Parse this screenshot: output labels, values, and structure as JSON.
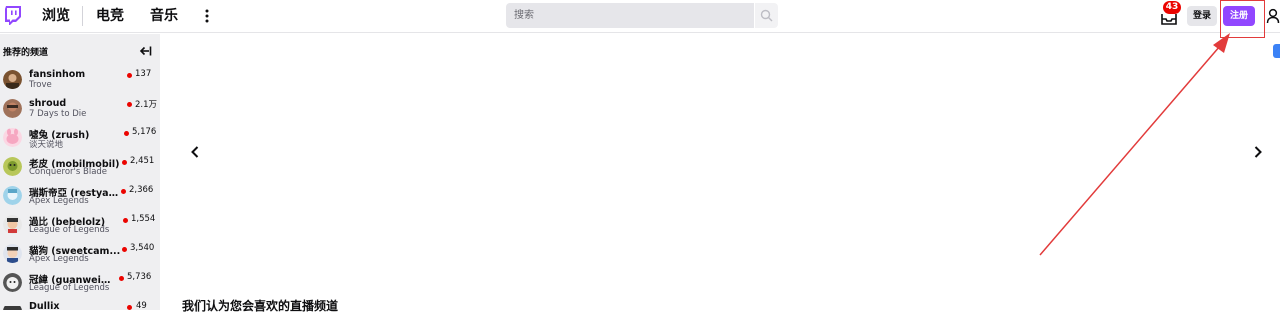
{
  "nav": {
    "links": [
      "浏览",
      "电竞",
      "音乐"
    ],
    "search_placeholder": "搜索",
    "notification_count": "43",
    "login_label": "登录",
    "signup_label": "注册"
  },
  "sidebar": {
    "title": "推荐的频道",
    "channels": [
      {
        "name": "fansinhom",
        "game": "Trove",
        "viewers": "137"
      },
      {
        "name": "shroud",
        "game": "7 Days to Die",
        "viewers": "2.1万"
      },
      {
        "name": "噓兔 (zrush)",
        "game": "谈天说地",
        "viewers": "5,176"
      },
      {
        "name": "老皮 (mobilmobil)",
        "game": "Conqueror's Blade",
        "viewers": "2,451"
      },
      {
        "name": "瑞斯帝亞 (restya_...",
        "game": "Apex Legends",
        "viewers": "2,366"
      },
      {
        "name": "過比 (bebelolz)",
        "game": "League of Legends",
        "viewers": "1,554"
      },
      {
        "name": "貓狗 (sweetcam...",
        "game": "Apex Legends",
        "viewers": "3,540"
      },
      {
        "name": "冠緯 (guanweiboy)",
        "game": "League of Legends",
        "viewers": "5,736"
      },
      {
        "name": "Dullix",
        "game": "",
        "viewers": "49"
      }
    ]
  },
  "main": {
    "section_title": "我们认为您会喜欢的直播频道"
  },
  "colors": {
    "brand": "#9147ff",
    "live": "#eb0400",
    "annotation": "#e23b3b"
  },
  "icons": [
    "twitch-logo",
    "more-vertical-icon",
    "search-icon",
    "inbox-icon",
    "user-icon",
    "collapse-icon",
    "chevron-left-icon",
    "chevron-right-icon"
  ]
}
